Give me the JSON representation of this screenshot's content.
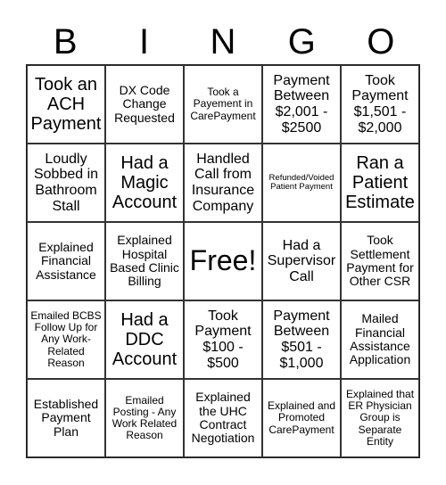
{
  "header": {
    "letters": [
      "B",
      "I",
      "N",
      "G",
      "O"
    ]
  },
  "cells": [
    "Took an ACH Payment",
    "DX Code Change Requested",
    "Took a Payement in CarePayment",
    "Payment Between $2,001 - $2500",
    "Took Payment $1,501 - $2,000",
    "Loudly Sobbed in Bathroom Stall",
    "Had a Magic Account",
    "Handled Call from Insurance Company",
    "Refunded/Voided Patient Payment",
    "Ran a Patient Estimate",
    "Explained Financial Assistance",
    "Explained Hospital Based Clinic Billing",
    "Free!",
    "Had a Supervisor Call",
    "Took Settlement Payment for Other CSR",
    "Emailed BCBS Follow Up for Any Work-Related Reason",
    "Had a DDC Account",
    "Took Payment $100 - $500",
    "Payment Between $501 - $1,000",
    "Mailed Financial Assistance Application",
    "Established Payment Plan",
    "Emailed Posting - Any Work Related Reason",
    "Explained the UHC Contract Negotiation",
    "Explained and Promoted CarePayment",
    "Explained that ER Physician Group is Separate Entity"
  ]
}
